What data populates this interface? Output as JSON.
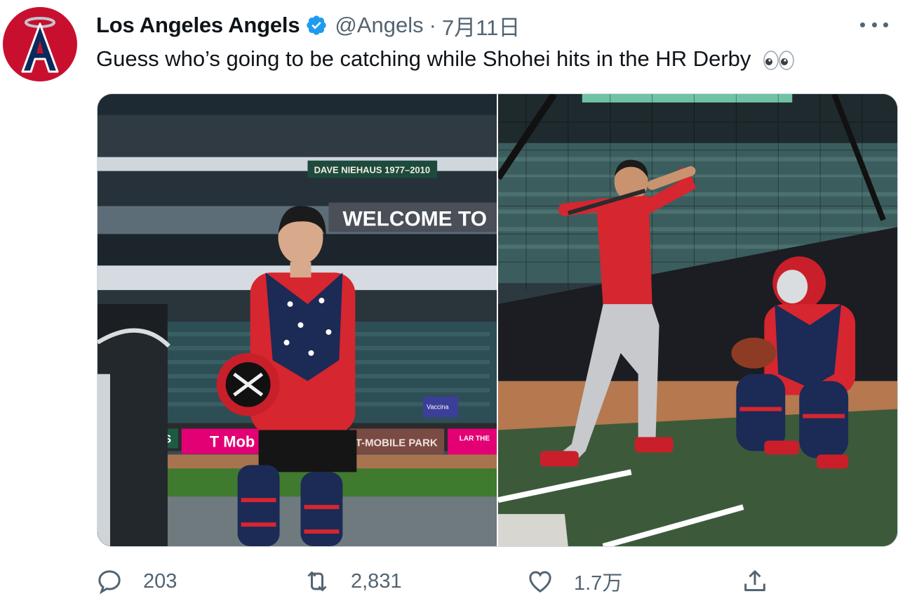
{
  "tweet": {
    "display_name": "Los Angeles Angels",
    "verified": true,
    "handle": "@Angels",
    "separator": "·",
    "date": "7月11日",
    "text": "Guess who’s going to be catching while Shohei hits in the HR Derby",
    "emoji": "eyes"
  },
  "media": {
    "left_photo": {
      "sign_upper": "DAVE NIEHAUS 1977–2010",
      "sign_welcome": "WELCOME TO",
      "ad_tmobile": "T Mob",
      "sign_park": "T-MOBILE PARK",
      "ad_right": "LAR THE",
      "ad_s": "S",
      "stand_sign": "Vaccina"
    },
    "right_photo": {}
  },
  "actions": {
    "reply_count": "203",
    "retweet_count": "2,831",
    "like_count": "1.7万"
  },
  "colors": {
    "brand_red": "#c8102e",
    "verified_blue": "#1d9bf0",
    "muted_text": "#536471"
  }
}
